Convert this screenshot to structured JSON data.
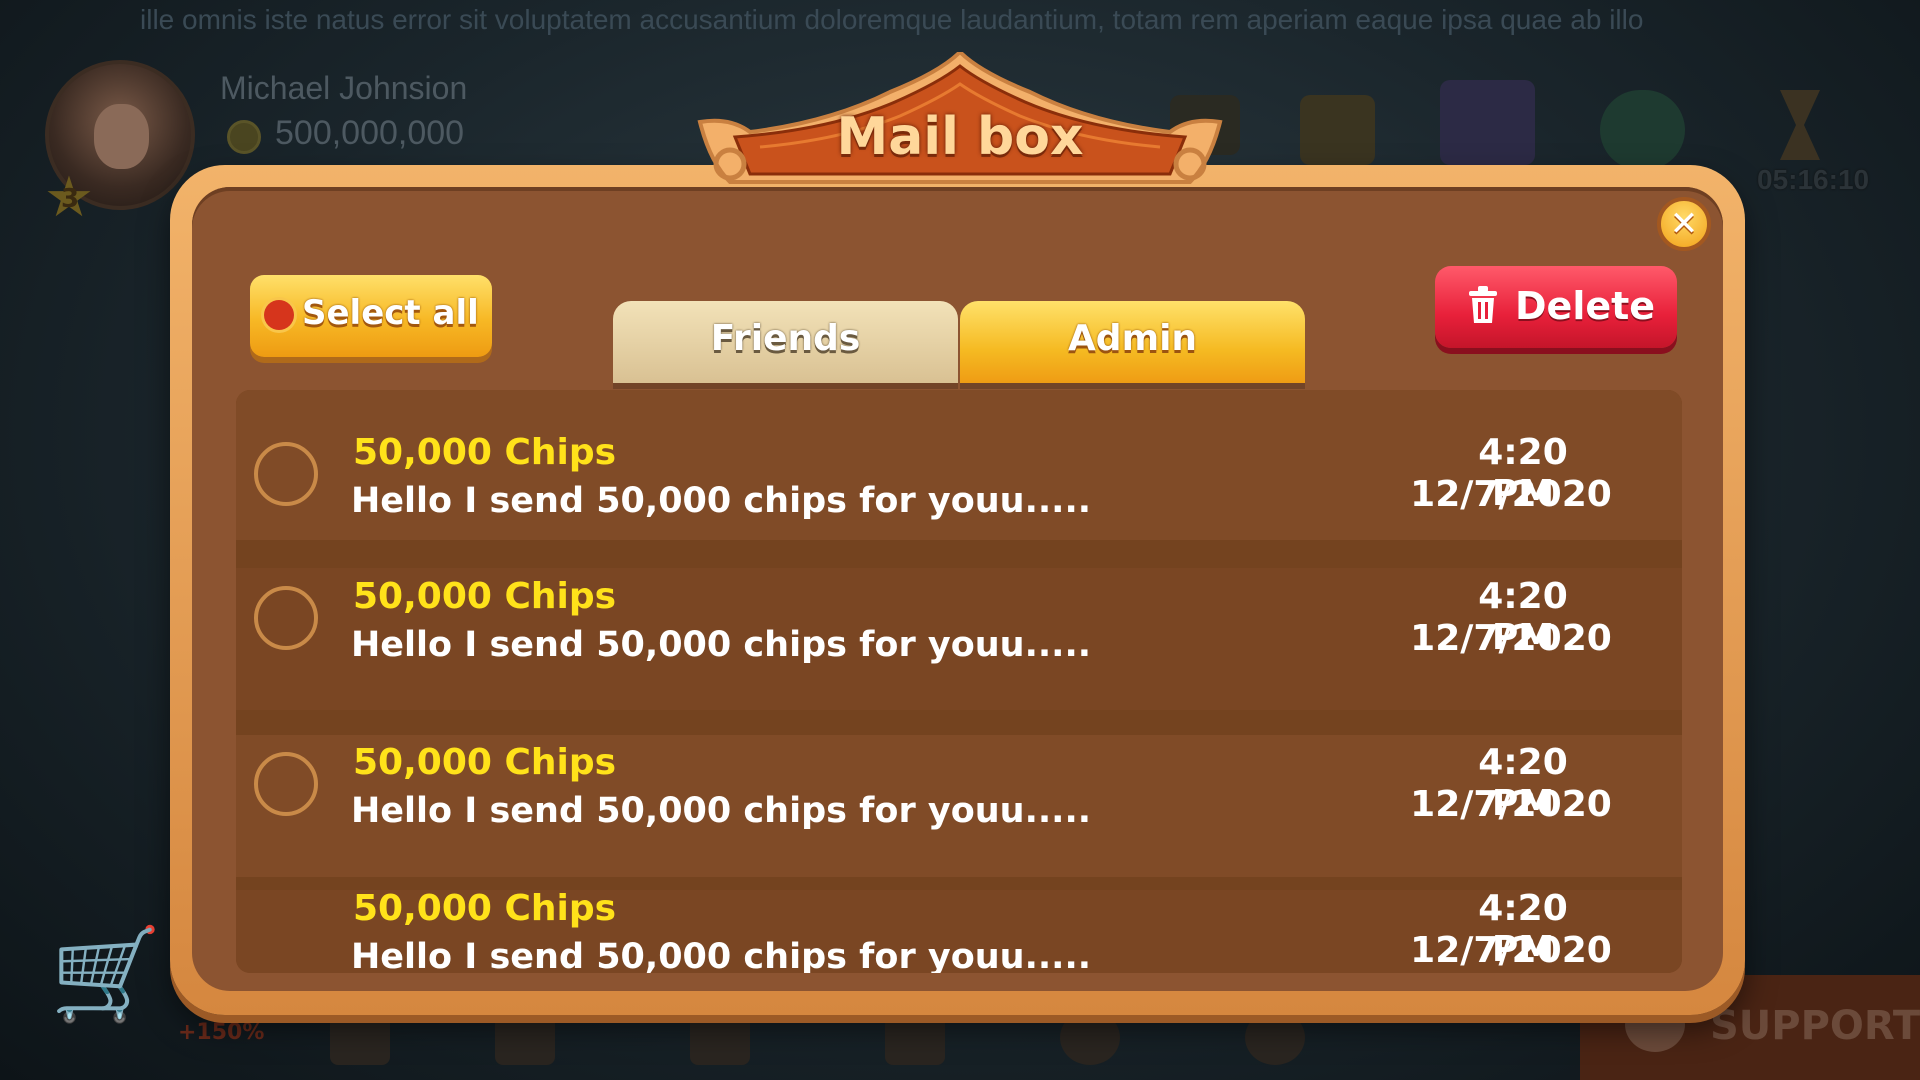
{
  "background": {
    "marquee": "ille omnis iste natus error sit voluptatem accusantium doloremque laudantium, totam rem aperiam eaque ipsa quae ab illo",
    "player": {
      "name": "Michael Johnsion",
      "chips": "500,000,000",
      "level": "3"
    },
    "timer": "05:16:10",
    "bonus": "+150%",
    "support_label": "SUPPORT"
  },
  "mailbox": {
    "title": "Mail box",
    "close_label": "✕",
    "select_all_label": "Select all",
    "delete_label": "Delete",
    "tabs": [
      {
        "label": "Friends",
        "active": false
      },
      {
        "label": "Admin",
        "active": true
      }
    ],
    "messages": [
      {
        "title": "50,000 Chips",
        "body": "Hello I send 50,000 chips for youu.....",
        "time": "4:20 PM",
        "date": "12/7/2020"
      },
      {
        "title": "50,000 Chips",
        "body": "Hello I send 50,000 chips for youu.....",
        "time": "4:20 PM",
        "date": "12/7/2020"
      },
      {
        "title": "50,000 Chips",
        "body": "Hello I send 50,000 chips for youu.....",
        "time": "4:20 PM",
        "date": "12/7/2020"
      },
      {
        "title": "50,000 Chips",
        "body": "Hello I send 50,000 chips for youu.....",
        "time": "4:20 PM",
        "date": "12/7/2020"
      }
    ]
  },
  "colors": {
    "panel_border": "#e09b4f",
    "panel_fill": "#8c5431",
    "message_title": "#ffe21a",
    "delete_red": "#e8203a",
    "active_tab": "#f5ba22"
  }
}
